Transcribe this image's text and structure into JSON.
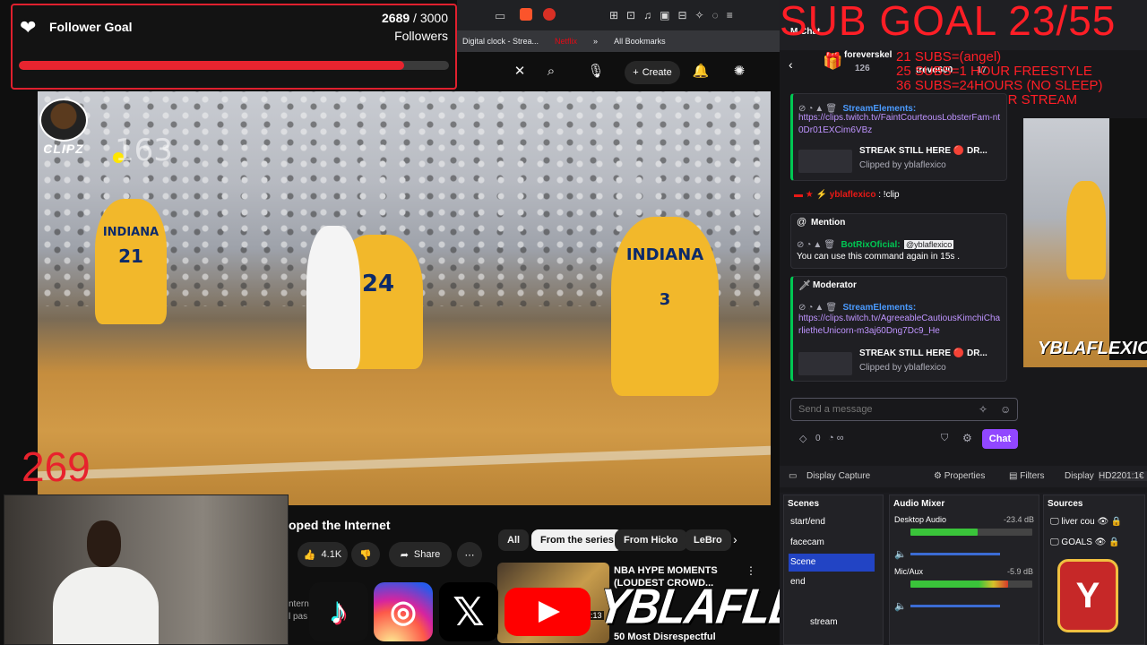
{
  "follower_goal": {
    "title": "Follower Goal",
    "current": "2689",
    "separator": " / ",
    "target": "3000",
    "unit": "Followers",
    "progress": 0.8963
  },
  "overlay": {
    "clipz_logo_text": "CLIPZ",
    "counter_top": "163",
    "counter_bottom": "269",
    "brand": "YBLAFLEXICO"
  },
  "browser": {
    "bookmarks": [
      "Digital clock - Strea...",
      "Netflix",
      "»",
      "All Bookmarks"
    ],
    "create_label": "Create"
  },
  "video": {
    "jersey_numbers": [
      "21",
      "24",
      "3"
    ],
    "jersey_text": "INDIANA",
    "title_fragment": "oped the Internet",
    "likes": "4.1K",
    "share_label": "Share"
  },
  "recommendations": {
    "chips": [
      "All",
      "From the series",
      "From Hicko",
      "LeBro"
    ],
    "card_title": "NBA HYPE MOMENTS (LOUDEST CROWD...",
    "card_subtitle": "50 Most Disrespectful",
    "card_duration": "0:13",
    "ghost_lines": [
      "ntern",
      "l pas"
    ]
  },
  "stream_overlay": {
    "sub_goal": "SUB GOAL 23/55",
    "sub_lines": [
      "21 SUBS=(angel)",
      "25 SUBS=1 HOUR  FREESTYLE",
      "36 SUBS=24HOURS (NO SLEEP)",
      "55 SUBS=24 HOUR STREAM"
    ]
  },
  "chat": {
    "header_label": "M Chat",
    "top_users": [
      {
        "name": "foreverskel",
        "count": "126"
      },
      {
        "name": "trevo600",
        "count": "17"
      }
    ],
    "messages": [
      {
        "user": "StreamElements:",
        "link": "https://clips.twitch.tv/FaintCourteousLobsterFam-nt0Dr01EXCim6VBz",
        "clip_title": "STREAK STILL HERE 🔴 DR...",
        "clip_by": "Clipped by yblaflexico"
      },
      {
        "user": "yblaflexico",
        "text": ": !clip"
      }
    ],
    "mention_card": {
      "title": "Mention",
      "user": "BotRixOficial:",
      "tag": "@yblaflexico",
      "text": "You can use this command again in 15s ."
    },
    "moderator_card": {
      "title": "Moderator",
      "user": "StreamElements:",
      "link": "https://clips.twitch.tv/AgreeableCautiousKimchiCharlietheUnicorn-m3aj60Dng7Dc9_He",
      "clip_title": "STREAK STILL HERE 🔴 DR...",
      "clip_by": "Clipped by yblaflexico"
    },
    "input_placeholder": "Send a message",
    "points": "0",
    "chat_button": "Chat"
  },
  "obs": {
    "display_capture": "Display Capture",
    "properties": "Properties",
    "filters": "Filters",
    "display": "Display",
    "display_value": "HD2201:1€",
    "scenes_title": "Scenes",
    "scenes": [
      "start/end",
      "facecam",
      "Scene",
      "end",
      "stream"
    ],
    "audio_title": "Audio Mixer",
    "audio_channels": [
      {
        "name": "Desktop Audio",
        "db": "-23.4 dB",
        "level": 0.55
      },
      {
        "name": "Mic/Aux",
        "db": "-5.9 dB",
        "level": 0.8
      }
    ],
    "sources_title": "Sources",
    "sources": [
      "liver cou",
      "GOALS"
    ]
  }
}
